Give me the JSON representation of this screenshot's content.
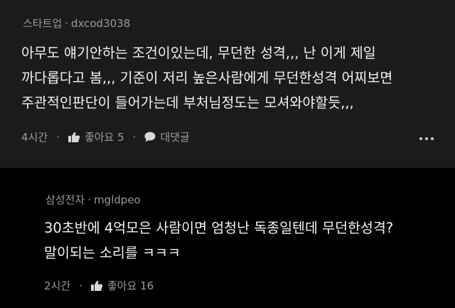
{
  "comments": [
    {
      "company": "스타트업",
      "username": "dxcod3038",
      "lines": [
        "아무도 얘기안하는 조건이있는데, 무던한 성격,,, 난 이게 제일",
        "까다롭다고 봄,,, 기준이 저리 높은사람에게 무던한성격 어찌보면",
        "주관적인판단이 들어가는데 부처님정도는 모셔와야할듯,,,"
      ],
      "time": "4시간",
      "like_label": "좋아요 5",
      "reply_label": "대댓글"
    },
    {
      "company": "삼성전자",
      "username": "mgldpeo",
      "lines": [
        "30초반에 4억모은 사람이면 엄청난 독종일텐데 무던한성격?",
        "말이되는 소리를 ㅋㅋㅋ"
      ],
      "time": "2시간",
      "like_label": "좋아요 16"
    }
  ],
  "separator": "·",
  "icons": [
    "thumbs-up-icon",
    "speech-bubble-icon",
    "more-options-icon"
  ],
  "colors": {
    "background": "#000000",
    "highlighted_comment_bg": "#1b1b1b",
    "text": "#f2f2f2",
    "secondary_text": "#9b9b9b"
  }
}
